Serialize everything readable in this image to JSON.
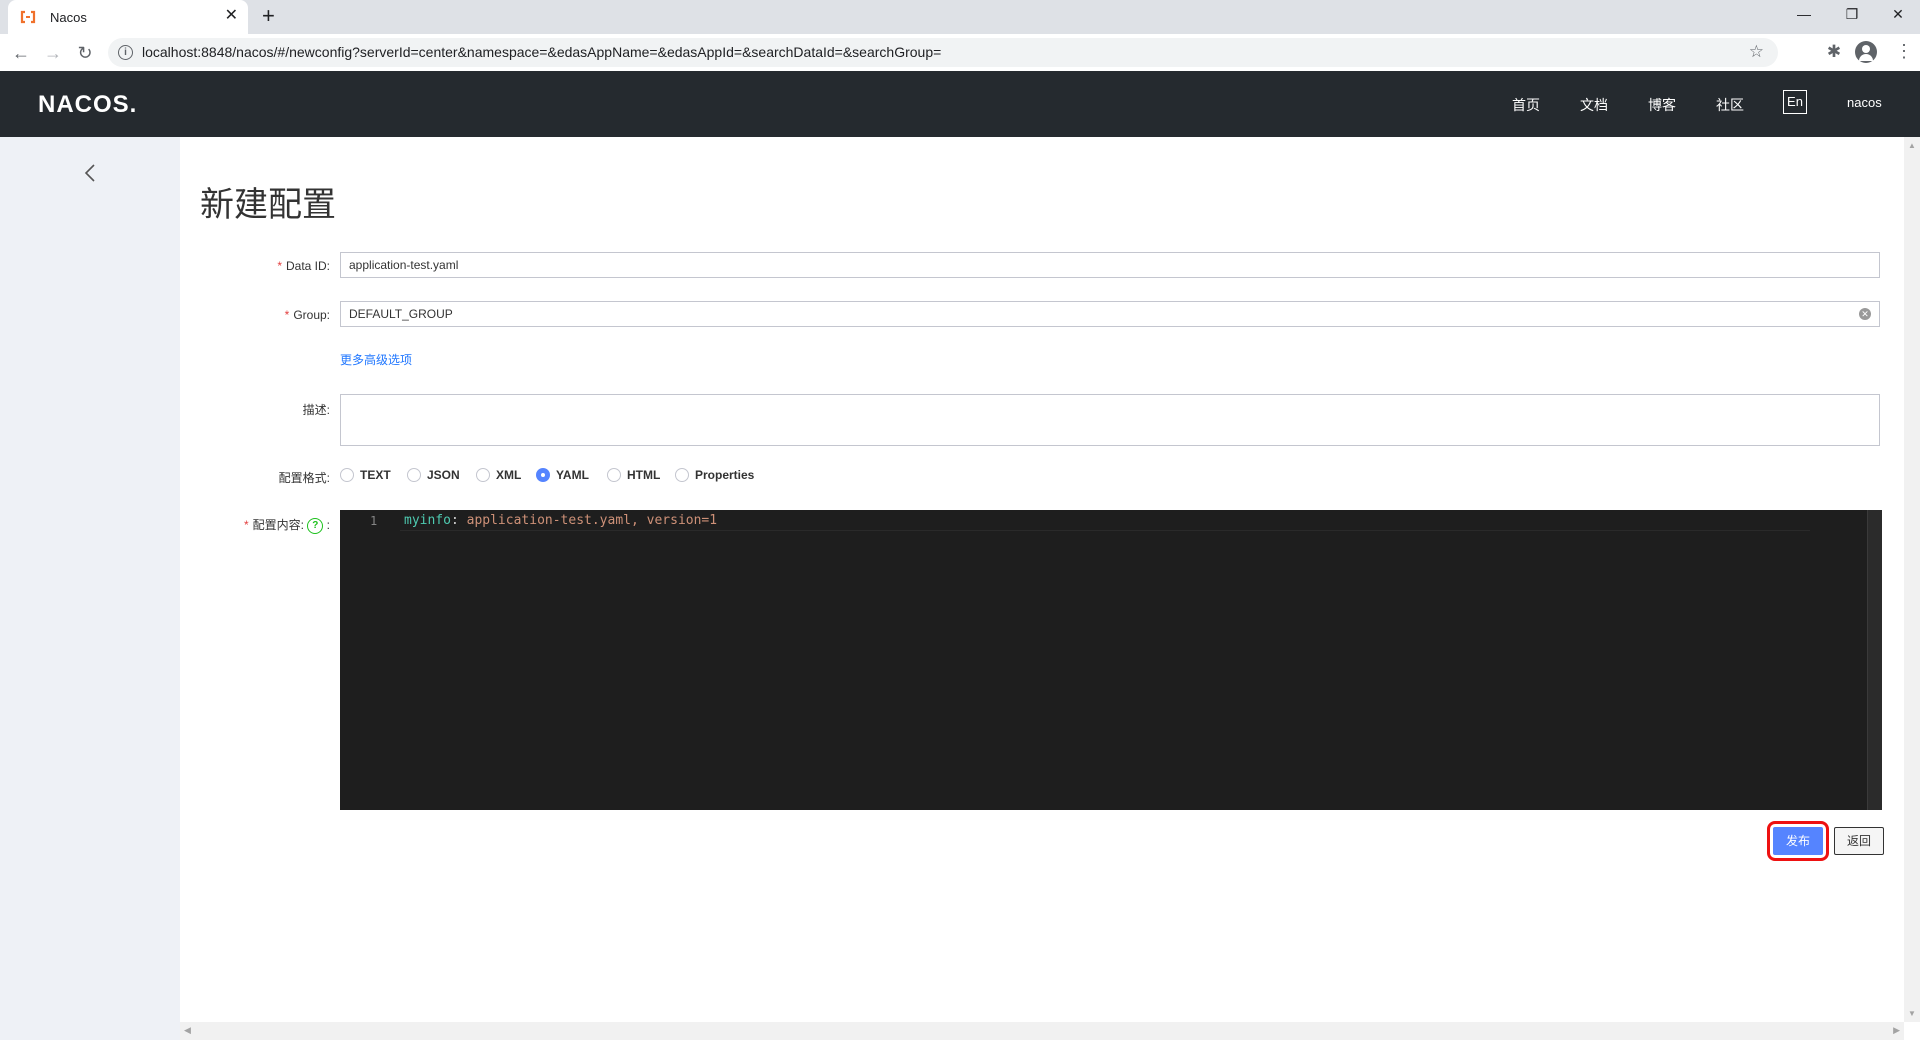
{
  "browser": {
    "tab_title": "Nacos",
    "tab_close": "✕",
    "new_tab": "+",
    "url": "localhost:8848/nacos/#/newconfig?serverId=center&namespace=&edasAppName=&edasAppId=&searchDataId=&searchGroup=",
    "window_controls": {
      "minimize": "—",
      "restore": "❐",
      "close": "✕"
    }
  },
  "header": {
    "logo": "NACOS.",
    "nav": [
      "首页",
      "文档",
      "博客",
      "社区"
    ],
    "lang": "En",
    "user": "nacos"
  },
  "page": {
    "title": "新建配置",
    "data_id_label": "Data ID:",
    "data_id_value": "application-test.yaml",
    "group_label": "Group:",
    "group_value": "DEFAULT_GROUP",
    "advanced_link": "更多高级选项",
    "desc_label": "描述:",
    "format_label": "配置格式:",
    "formats": [
      "TEXT",
      "JSON",
      "XML",
      "YAML",
      "HTML",
      "Properties"
    ],
    "selected_format": "YAML",
    "content_label": "配置内容:",
    "editor": {
      "line_number": "1",
      "key": "myinfo",
      "separator": ": ",
      "value": "application-test.yaml, version=1"
    },
    "publish_button": "发布",
    "return_button": "返回"
  }
}
